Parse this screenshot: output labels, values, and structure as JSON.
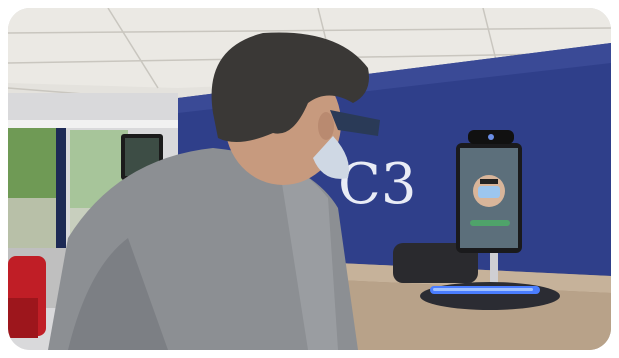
{
  "scene": {
    "wall_logo_text": "C3"
  },
  "colors": {
    "wall_blue": "#2f3f8a",
    "ceiling": "#e6e4df",
    "sweater": "#8c8f93",
    "hair": "#3a3836",
    "desk_top": "#b9a58e",
    "kiosk_light": "#4a7dff",
    "screen_green": "#4fa36a",
    "chair_red": "#c01e26"
  }
}
